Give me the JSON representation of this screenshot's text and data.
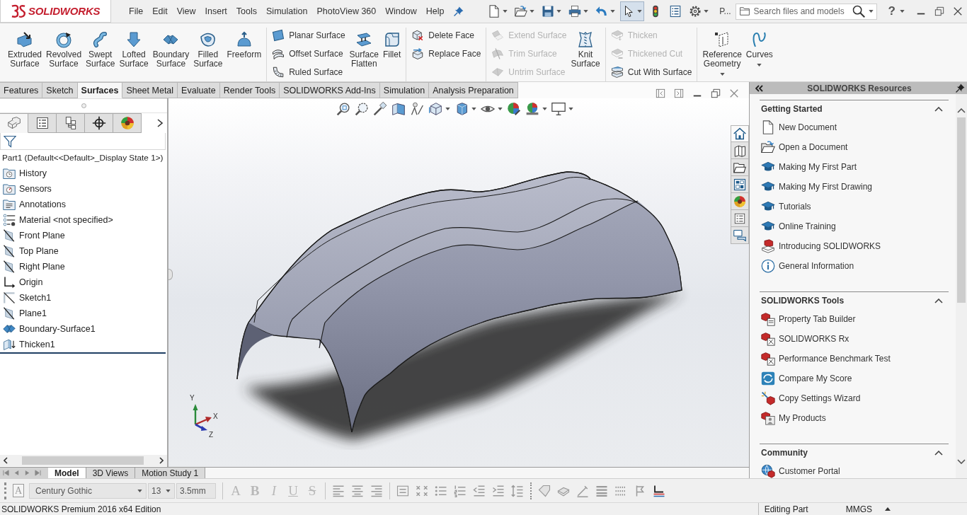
{
  "app": {
    "logo": "SOLIDWORKS"
  },
  "menu": [
    "File",
    "Edit",
    "View",
    "Insert",
    "Tools",
    "Simulation",
    "PhotoView 360",
    "Window",
    "Help"
  ],
  "quick_access": {
    "buttons": [
      {
        "pressed": false,
        "dropdown": true
      },
      {
        "pressed": false,
        "dropdown": true
      },
      {
        "pressed": false,
        "dropdown": true
      },
      {
        "pressed": false,
        "dropdown": true
      },
      {
        "pressed": false,
        "dropdown": true
      },
      {
        "pressed": true,
        "dropdown": true
      },
      {
        "pressed": false,
        "dropdown": false
      },
      {
        "pressed": false,
        "dropdown": false
      },
      {
        "pressed": false,
        "dropdown": true
      }
    ],
    "overflow_label": "P...",
    "search": {
      "placeholder": "Search files and models"
    },
    "help": "?"
  },
  "ribbon": {
    "groups": [
      {
        "tools": [
          {
            "label": "Extruded Surface",
            "kind": "large",
            "disabled": false,
            "dropdown": false
          },
          {
            "label": "Revolved Surface",
            "kind": "large",
            "disabled": false,
            "dropdown": false
          },
          {
            "label": "Swept Surface",
            "kind": "large",
            "disabled": false,
            "dropdown": false
          },
          {
            "label": "Lofted Surface",
            "kind": "large",
            "disabled": false,
            "dropdown": false
          },
          {
            "label": "Boundary Surface",
            "kind": "large",
            "disabled": false,
            "dropdown": false
          },
          {
            "label": "Filled Surface",
            "kind": "large",
            "disabled": false,
            "dropdown": false
          },
          {
            "label": "Freeform",
            "kind": "large",
            "disabled": false,
            "dropdown": false
          }
        ]
      },
      {
        "tools": [
          {
            "label": "Planar Surface",
            "kind": "small",
            "disabled": false,
            "dropdown": false
          },
          {
            "label": "Offset Surface",
            "kind": "small",
            "disabled": false,
            "dropdown": false
          },
          {
            "label": "Ruled Surface",
            "kind": "small",
            "disabled": false,
            "dropdown": false
          },
          {
            "label": "Surface Flatten",
            "kind": "large",
            "disabled": false,
            "dropdown": false
          },
          {
            "label": "Fillet",
            "kind": "large",
            "disabled": false,
            "dropdown": false
          }
        ]
      },
      {
        "tools": [
          {
            "label": "Delete Face",
            "kind": "small",
            "disabled": false,
            "dropdown": false
          },
          {
            "label": "Replace Face",
            "kind": "small",
            "disabled": false,
            "dropdown": false
          }
        ]
      },
      {
        "tools": [
          {
            "label": "Extend Surface",
            "kind": "small",
            "disabled": true,
            "dropdown": false
          },
          {
            "label": "Trim Surface",
            "kind": "small",
            "disabled": true,
            "dropdown": false
          },
          {
            "label": "Untrim Surface",
            "kind": "small",
            "disabled": true,
            "dropdown": false
          },
          {
            "label": "Knit Surface",
            "kind": "large",
            "disabled": false,
            "dropdown": false
          }
        ]
      },
      {
        "tools": [
          {
            "label": "Thicken",
            "kind": "small",
            "disabled": true,
            "dropdown": false
          },
          {
            "label": "Thickened Cut",
            "kind": "small",
            "disabled": true,
            "dropdown": false
          },
          {
            "label": "Cut With Surface",
            "kind": "small",
            "disabled": false,
            "dropdown": false
          }
        ]
      },
      {
        "tools": [
          {
            "label": "Reference Geometry",
            "kind": "large",
            "disabled": false,
            "dropdown": true
          },
          {
            "label": "Curves",
            "kind": "large",
            "disabled": false,
            "dropdown": true
          }
        ]
      }
    ]
  },
  "command_tabs": [
    {
      "label": "Features",
      "selected": false
    },
    {
      "label": "Sketch",
      "selected": false
    },
    {
      "label": "Surfaces",
      "selected": true
    },
    {
      "label": "Sheet Metal",
      "selected": false
    },
    {
      "label": "Evaluate",
      "selected": false
    },
    {
      "label": "Render Tools",
      "selected": false
    },
    {
      "label": "SOLIDWORKS Add-Ins",
      "selected": false
    },
    {
      "label": "Simulation",
      "selected": false
    },
    {
      "label": "Analysis Preparation",
      "selected": false
    }
  ],
  "feature_manager": {
    "tabs": [
      {
        "selected": true
      },
      {
        "selected": false
      },
      {
        "selected": false
      },
      {
        "selected": false
      },
      {
        "selected": false
      }
    ],
    "root": "Part1 (Default<<Default>_Display State 1>)",
    "items": [
      {
        "label": "History",
        "kind": "history"
      },
      {
        "label": "Sensors",
        "kind": "sensors"
      },
      {
        "label": "Annotations",
        "kind": "annotations"
      },
      {
        "label": "Material <not specified>",
        "kind": "material"
      },
      {
        "label": "Front Plane",
        "kind": "plane"
      },
      {
        "label": "Top Plane",
        "kind": "plane"
      },
      {
        "label": "Right Plane",
        "kind": "plane"
      },
      {
        "label": "Origin",
        "kind": "origin"
      },
      {
        "label": "Sketch1",
        "kind": "sketch"
      },
      {
        "label": "Plane1",
        "kind": "plane"
      },
      {
        "label": "Boundary-Surface1",
        "kind": "surface"
      },
      {
        "label": "Thicken1",
        "kind": "thicken"
      }
    ]
  },
  "heads_up_toolbar": [
    {
      "dropdown": false
    },
    {
      "dropdown": false
    },
    {
      "dropdown": false
    },
    {
      "dropdown": false
    },
    {
      "dropdown": false
    },
    {
      "dropdown": true
    },
    {
      "dropdown": true
    },
    {
      "dropdown": true
    },
    {
      "dropdown": false
    },
    {
      "dropdown": true
    },
    {
      "dropdown": true
    }
  ],
  "view_triad": {
    "axes": [
      "Y",
      "X",
      "Z"
    ]
  },
  "task_pane_tabs": [
    {
      "selected": true
    },
    {
      "selected": false
    },
    {
      "selected": false
    },
    {
      "selected": false
    },
    {
      "selected": false
    },
    {
      "selected": false
    },
    {
      "selected": false
    }
  ],
  "bottom_tabs": [
    {
      "label": "Model",
      "selected": true
    },
    {
      "label": "3D Views",
      "selected": false
    },
    {
      "label": "Motion Study 1",
      "selected": false
    }
  ],
  "task_pane": {
    "title": "SOLIDWORKS Resources",
    "sections": [
      {
        "title": "Getting Started",
        "expanded": true,
        "items": [
          "New Document",
          "Open a Document",
          "Making My First Part",
          "Making My First Drawing",
          "Tutorials",
          "Online Training",
          "Introducing SOLIDWORKS",
          "General Information"
        ]
      },
      {
        "title": "SOLIDWORKS Tools",
        "expanded": true,
        "items": [
          "Property Tab Builder",
          "SOLIDWORKS Rx",
          "Performance Benchmark Test",
          "Compare My Score",
          "Copy Settings Wizard",
          "My Products"
        ]
      },
      {
        "title": "Community",
        "expanded": true,
        "items": [
          "Customer Portal"
        ]
      }
    ]
  },
  "format_toolbar": {
    "style_picker": {
      "label": "A",
      "disabled": true
    },
    "font": "Century Gothic",
    "size": "13",
    "height": "3.5mm",
    "styles": [
      {
        "label": "A",
        "kind": "font",
        "disabled": true
      },
      {
        "label": "B",
        "kind": "bold",
        "disabled": true
      },
      {
        "label": "I",
        "kind": "italic",
        "disabled": true
      },
      {
        "label": "U",
        "kind": "underline",
        "disabled": true
      },
      {
        "label": "S",
        "kind": "strike",
        "disabled": true
      }
    ]
  },
  "status_bar": {
    "edition": "SOLIDWORKS Premium 2016 x64 Edition",
    "mode": "Editing Part",
    "units": "MMGS"
  }
}
